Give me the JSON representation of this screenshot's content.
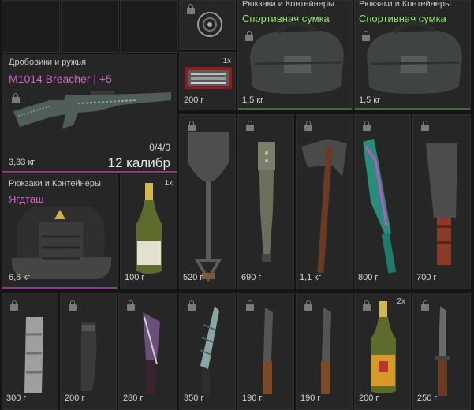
{
  "shotgun": {
    "category": "Дробовики и ружья",
    "name": "M1014 Breacher | +5",
    "weight": "3,33 кг",
    "ammo": "0/4/0",
    "caliber": "12 калибр"
  },
  "backpack_main": {
    "category": "Рюкзаки и Контейнеры",
    "name": "Ягдташ",
    "weight": "6,6 кг"
  },
  "sport_bag_1": {
    "category": "Рюкзаки и Контейнеры",
    "name": "Спортивная сумка",
    "weight": "1,5 кг"
  },
  "sport_bag_2": {
    "category": "Рюкзаки и Контейнеры",
    "name": "Спортивная сумка",
    "weight": "1,5 кг"
  },
  "toolcase": {
    "qty": "1x",
    "weight": "200 г"
  },
  "champagne_1": {
    "qty": "1x",
    "weight": "100 г"
  },
  "shovel": {
    "weight": "520 г"
  },
  "bat": {
    "weight": "690 г"
  },
  "axe": {
    "weight": "1,1 кг"
  },
  "machete_1": {
    "weight": "800 г"
  },
  "machete_2": {
    "weight": "700 г"
  },
  "mag_1": {
    "weight": "300 г"
  },
  "mag_2": {
    "weight": "200 г"
  },
  "knife_1": {
    "weight": "280 г"
  },
  "knife_2": {
    "weight": "350 г"
  },
  "knife_3": {
    "weight": "190 г"
  },
  "knife_4": {
    "weight": "190 г"
  },
  "champagne_2": {
    "qty": "2x",
    "weight": "200 г"
  },
  "bayonet": {
    "weight": "250 г"
  },
  "colors": {
    "green": "#8ee66a",
    "pink": "#d063c9",
    "panel": "#262626"
  }
}
